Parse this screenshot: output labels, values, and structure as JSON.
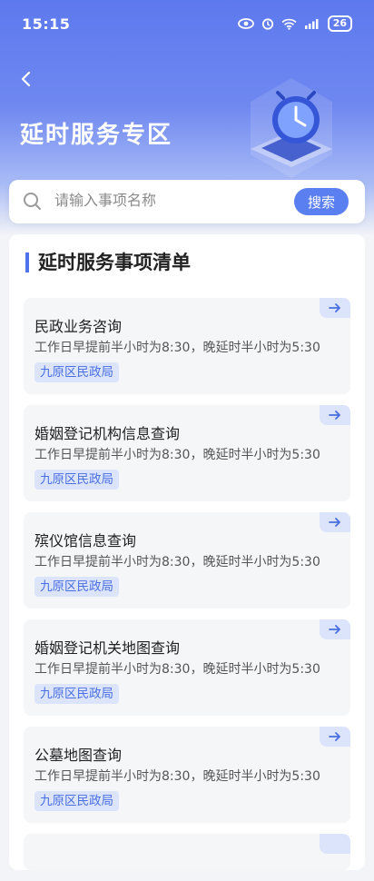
{
  "status_bar": {
    "time": "15:15",
    "battery": "26",
    "icons": [
      "eye-icon",
      "alarm-icon",
      "wifi-icon",
      "signal-icon",
      "battery-icon"
    ]
  },
  "header": {
    "title": "延时服务专区",
    "back_icon": "chevron-left-icon"
  },
  "search": {
    "placeholder": "请输入事项名称",
    "value": "",
    "button_label": "搜索"
  },
  "section": {
    "title": "延时服务事项清单"
  },
  "items": [
    {
      "name": "民政业务咨询",
      "time": "工作日早提前半小时为8:30，晚延时半小时为5:30",
      "tag": "九原区民政局"
    },
    {
      "name": "婚姻登记机构信息查询",
      "time": "工作日早提前半小时为8:30，晚延时半小时为5:30",
      "tag": "九原区民政局"
    },
    {
      "name": "殡仪馆信息查询",
      "time": "工作日早提前半小时为8:30，晚延时半小时为5:30",
      "tag": "九原区民政局"
    },
    {
      "name": "婚姻登记机关地图查询",
      "time": "工作日早提前半小时为8:30，晚延时半小时为5:30",
      "tag": "九原区民政局"
    },
    {
      "name": "公墓地图查询",
      "time": "工作日早提前半小时为8:30，晚延时半小时为5:30",
      "tag": "九原区民政局"
    }
  ],
  "colors": {
    "accent": "#5a7ff0",
    "tag_bg": "#dbe4fb",
    "tag_text": "#4a6fe0"
  }
}
